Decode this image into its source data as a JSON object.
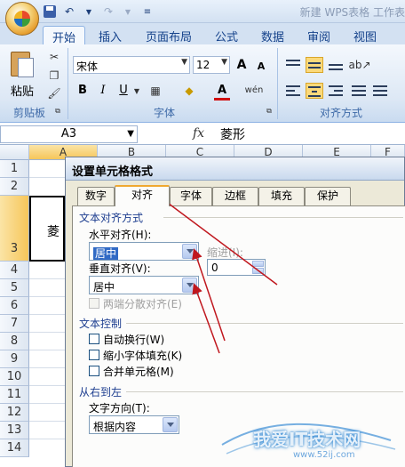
{
  "window": {
    "title": "新建 WPS表格 工作表"
  },
  "ribbon_tabs": [
    "开始",
    "插入",
    "页面布局",
    "公式",
    "数据",
    "审阅",
    "视图"
  ],
  "active_tab": "开始",
  "clipboard": {
    "paste_label": "粘贴",
    "group_label": "剪贴板"
  },
  "font": {
    "name": "宋体",
    "size": "12",
    "group_label": "字体",
    "grow": "A",
    "shrink": "A",
    "bold": "B",
    "italic": "I",
    "underline": "U",
    "color_letter": "A",
    "phonetic": "wén"
  },
  "alignment": {
    "group_label": "对齐方式"
  },
  "formula_bar": {
    "cell_ref": "A3",
    "fx": "fx",
    "content": "菱形"
  },
  "sheet": {
    "columns": [
      "A",
      "B",
      "C",
      "D",
      "E",
      "F"
    ],
    "rows": [
      "1",
      "2",
      "3",
      "4",
      "5",
      "6",
      "7",
      "8",
      "9",
      "10",
      "11",
      "12",
      "13",
      "14"
    ],
    "a3_value": "菱"
  },
  "dialog": {
    "title": "设置单元格格式",
    "tabs": [
      "数字",
      "对齐",
      "字体",
      "边框",
      "填充",
      "保护"
    ],
    "active_tab": "对齐",
    "text_align_section": "文本对齐方式",
    "h_align_label": "水平对齐(H):",
    "h_align_value": "居中",
    "indent_label": "缩进(I):",
    "indent_value": "0",
    "v_align_label": "垂直对齐(V):",
    "v_align_value": "居中",
    "distributed_label": "两端分散对齐(E)",
    "text_control_section": "文本控制",
    "wrap_label": "自动换行(W)",
    "shrink_label": "缩小字体填充(K)",
    "merge_label": "合并单元格(M)",
    "rtl_section": "从右到左",
    "text_dir_label": "文字方向(T):",
    "text_dir_value": "根据内容"
  },
  "watermark": {
    "text": "我爱IT技术网",
    "url": "www.52ij.com"
  },
  "colors": {
    "annotation_arrow": "#c0171e",
    "ribbon_text": "#15428b",
    "section_text": "#1c3d8f"
  }
}
